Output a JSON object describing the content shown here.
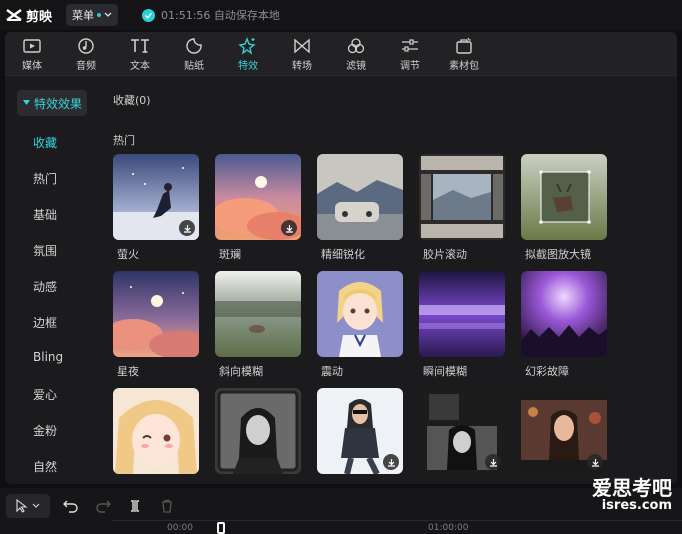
{
  "app": {
    "name": "剪映",
    "menu_label": "菜单",
    "save_status": "01:51:56 自动保存本地"
  },
  "toolbar": {
    "items": [
      {
        "label": "媒体",
        "icon": "media-icon"
      },
      {
        "label": "音频",
        "icon": "audio-icon"
      },
      {
        "label": "文本",
        "icon": "text-icon"
      },
      {
        "label": "贴纸",
        "icon": "sticker-icon"
      },
      {
        "label": "特效",
        "icon": "effects-icon",
        "active": true
      },
      {
        "label": "转场",
        "icon": "transition-icon"
      },
      {
        "label": "滤镜",
        "icon": "filter-icon"
      },
      {
        "label": "调节",
        "icon": "adjust-icon"
      },
      {
        "label": "素材包",
        "icon": "material-pack-icon"
      }
    ]
  },
  "sidebar": {
    "header": "特效效果",
    "items": [
      "收藏",
      "热门",
      "基础",
      "氛围",
      "动感",
      "边框",
      "Bling",
      "爱心",
      "金粉",
      "自然"
    ]
  },
  "content": {
    "favorites_title": "收藏(0)",
    "hot_title": "热门",
    "effects": [
      "萤火",
      "斑斓",
      "精细锐化",
      "胶片滚动",
      "拟截图放大镜",
      "星夜",
      "斜向模糊",
      "震动",
      "瞬间模糊",
      "幻彩故障",
      "",
      "",
      "",
      "",
      ""
    ]
  },
  "timeline": {
    "ticks": [
      "00:00",
      "01:00:00"
    ]
  },
  "watermark": {
    "line1": "爱思考吧",
    "line2": "isres.com"
  }
}
